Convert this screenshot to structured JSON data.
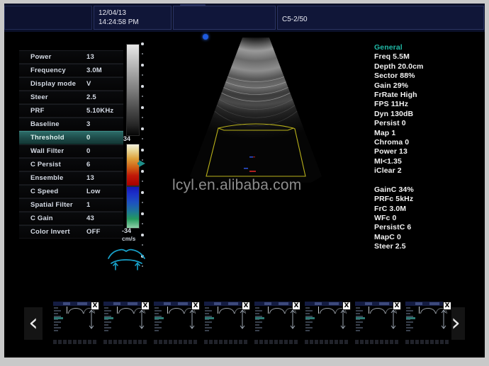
{
  "header": {
    "date": "12/04/13",
    "time": "14:24:58 PM",
    "probe": "C5-2/50"
  },
  "watermark": "lcyl.en.alibaba.com",
  "color_scale": {
    "top_value": "34",
    "bottom_value": "-34",
    "unit": "cm/s"
  },
  "parameters": [
    {
      "name": "Power",
      "value": "13",
      "selected": false
    },
    {
      "name": "Frequency",
      "value": "3.0M",
      "selected": false
    },
    {
      "name": "Display mode",
      "value": "V",
      "selected": false
    },
    {
      "name": "Steer",
      "value": "2.5",
      "selected": false
    },
    {
      "name": "PRF",
      "value": "5.10KHz",
      "selected": false
    },
    {
      "name": "Baseline",
      "value": "3",
      "selected": false
    },
    {
      "name": "Threshold",
      "value": "0",
      "selected": true
    },
    {
      "name": "Wall Filter",
      "value": "0",
      "selected": false
    },
    {
      "name": "C Persist",
      "value": "6",
      "selected": false
    },
    {
      "name": "Ensemble",
      "value": "13",
      "selected": false
    },
    {
      "name": "C Speed",
      "value": "Low",
      "selected": false
    },
    {
      "name": "Spatial Filter",
      "value": "1",
      "selected": false
    },
    {
      "name": "C Gain",
      "value": "43",
      "selected": false
    },
    {
      "name": "Color Invert",
      "value": "OFF",
      "selected": false
    }
  ],
  "info_panel": {
    "heading": "General",
    "b_mode": [
      "Freq 5.5M",
      "Depth 20.0cm",
      "Sector 88%",
      "Gain 29%",
      "FrRate High",
      "FPS 11Hz",
      "Dyn 130dB",
      "Persist 0",
      "Map 1",
      "Chroma 0",
      "Power 13",
      "MI<1.35",
      "iClear 2"
    ],
    "color_mode": [
      "GainC 34%",
      "PRFc 5kHz",
      "FrC 3.0M",
      "WFc 0",
      "PersistC 6",
      "MapC 0",
      "Steer 2.5"
    ]
  },
  "thumbnail_strip": {
    "prev_label": "‹",
    "next_label": "›",
    "close_label": "X",
    "count": 8
  }
}
